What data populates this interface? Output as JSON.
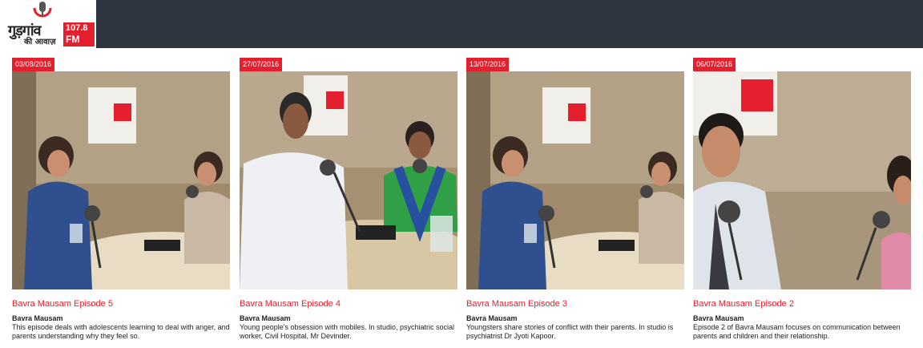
{
  "logo": {
    "hindi_line1": "गुड़गांव",
    "hindi_line2": "की आवाज़",
    "frequency": "107.8",
    "band": "FM"
  },
  "episodes": [
    {
      "date": "03/08/2016",
      "title": "Bavra Mausam Episode 5",
      "program": "Bavra Mausam",
      "description": "This episode deals with adolescents learning to deal with anger, and parents understanding why they feel so."
    },
    {
      "date": "27/07/2016",
      "title": "Bavra Mausam Episode 4",
      "program": "Bavra Mausam",
      "description": "Young people's obsession with mobiles. In studio, psychiatric social worker, Civil Hospital, Mr Devinder."
    },
    {
      "date": "13/07/2016",
      "title": "Bavra Mausam Episode 3",
      "program": "Bavra Mausam",
      "description": "Youngsters share stories of conflict with their parents. In studio is psychiatrist Dr Jyoti Kapoor."
    },
    {
      "date": "06/07/2016",
      "title": "Bavra Mausam Episode 2",
      "program": "Bavra Mausam",
      "description": "Episode 2 of Bavra Mausam focuses on communication between parents and children and their relationship."
    }
  ],
  "colors": {
    "accent": "#e5202e",
    "header_bg": "#2c3540",
    "text": "#222222"
  }
}
